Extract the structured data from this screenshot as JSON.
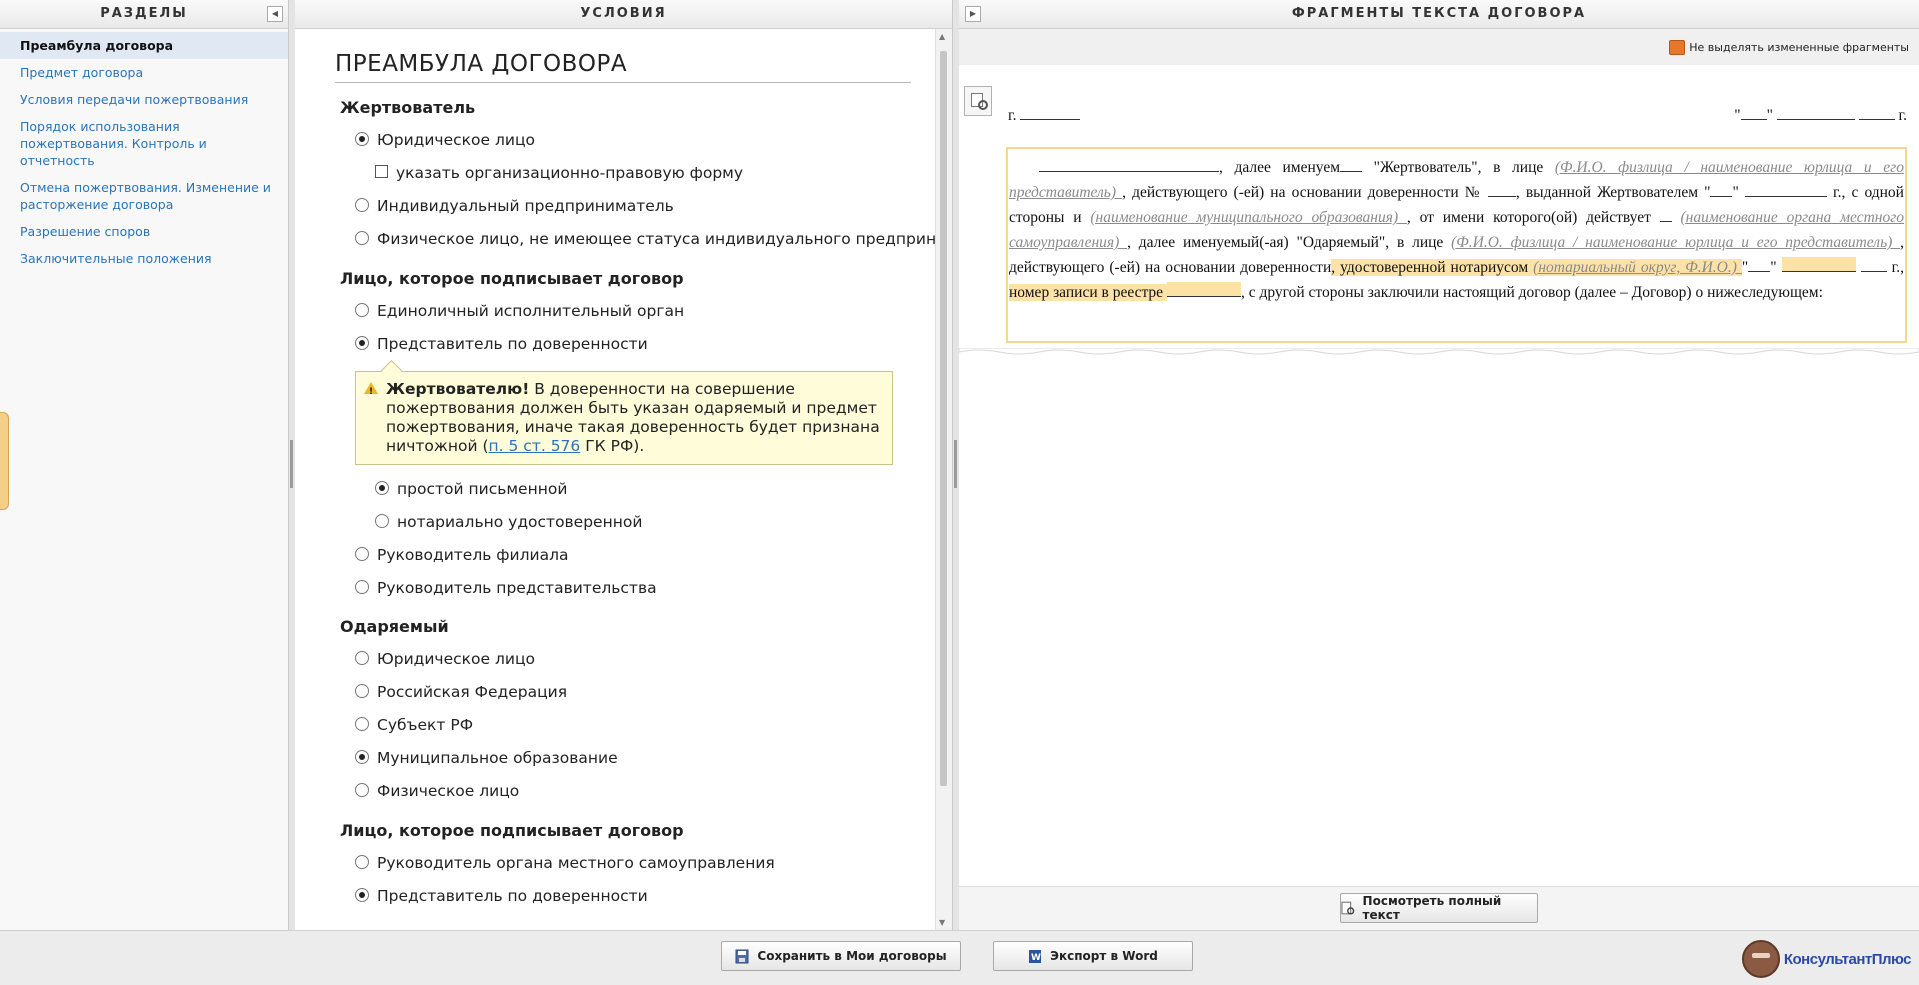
{
  "left": {
    "title": "РАЗДЕЛЫ",
    "items": [
      {
        "label": "Преамбула договора",
        "active": true
      },
      {
        "label": "Предмет договора"
      },
      {
        "label": "Условия  передачи пожертвования"
      },
      {
        "label": "Порядок использования пожертвования. Контроль и отчетность"
      },
      {
        "label": "Отмена пожертвования. Изменение и расторжение договора"
      },
      {
        "label": "Разрешение споров"
      },
      {
        "label": "Заключительные положения"
      }
    ]
  },
  "middle": {
    "title": "УСЛОВИЯ",
    "heading": "ПРЕАМБУЛА ДОГОВОРА",
    "groups": [
      {
        "title": "Жертвователь",
        "options": [
          "Юридическое лицо",
          "указать организационно-правовую форму",
          "Индивидуальный предприниматель",
          "Физическое лицо, не имеющее статуса индивидуального предпринимателя"
        ]
      },
      {
        "title": "Лицо, которое подписывает договор",
        "options": [
          "Единоличный исполнительный орган",
          "Представитель по доверенности",
          "простой письменной",
          "нотариально удостоверенной",
          "Руководитель филиала",
          "Руководитель представительства"
        ]
      },
      {
        "title": "Одаряемый",
        "options": [
          "Юридическое лицо",
          "Российская Федерация",
          "Субъект РФ",
          "Муниципальное образование",
          "Физическое лицо"
        ]
      },
      {
        "title": "Лицо, которое подписывает договор",
        "options": [
          "Руководитель органа местного самоуправления",
          "Представитель по доверенности"
        ]
      }
    ],
    "note": {
      "bold": "Жертвователю!",
      "text": " В доверенности на совершение пожертвования должен быть указан одаряемый и предмет пожертвования, иначе такая доверенность будет признана ничтожной (",
      "link": "п. 5 ст. 576",
      "tail": " ГК РФ)."
    }
  },
  "right": {
    "title": "ФРАГМЕНТЫ ТЕКСТА ДОГОВОРА",
    "toggle_label": "Не выделять измененные фрагменты",
    "city_prefix": "г.",
    "date_quote_open": "\"",
    "date_quote_close": "\"",
    "date_suffix": "г.",
    "fragment": {
      "t1": ", далее именуем",
      "t2": " \"Жертвователь\", в лице ",
      "p1": "  (Ф.И.О. физлица / наименование юрлица и его представитель)  ",
      "t3": ", действующего (-ей) на основании доверенности № ",
      "t4": ", выданной Жертвователем \"",
      "t5": "\" ",
      "t6": " г., с одной стороны и ",
      "p2": "  (наименование муниципального образования)  ",
      "t7": ", от имени которого(ой) действует ",
      "p3": "(наименование органа местного самоуправления)  ",
      "t8": ", далее именуемый(-ая) \"Одаряемый\", в лице ",
      "p4": "  (Ф.И.О. физлица / наименование юрлица и его представитель)  ",
      "t9": ", действующего (-ей) на основании доверенности",
      "h1": ", удостоверенной нотариусом ",
      "p5": "  (нотариальный округ, Ф.И.О.)  ",
      "t10": " \"",
      "t11": "\" ",
      "t12": " г., ",
      "h2": "номер записи в реестре ",
      "t13": ", с другой стороны заключили настоящий договор (далее – Договор) о нижеследующем:"
    },
    "view_full_label": "Посмотреть полный текст"
  },
  "bottom": {
    "save_label": "Сохранить в Мои договоры",
    "export_label": "Экспорт в Word",
    "brand": "КонсультантПлюс"
  }
}
